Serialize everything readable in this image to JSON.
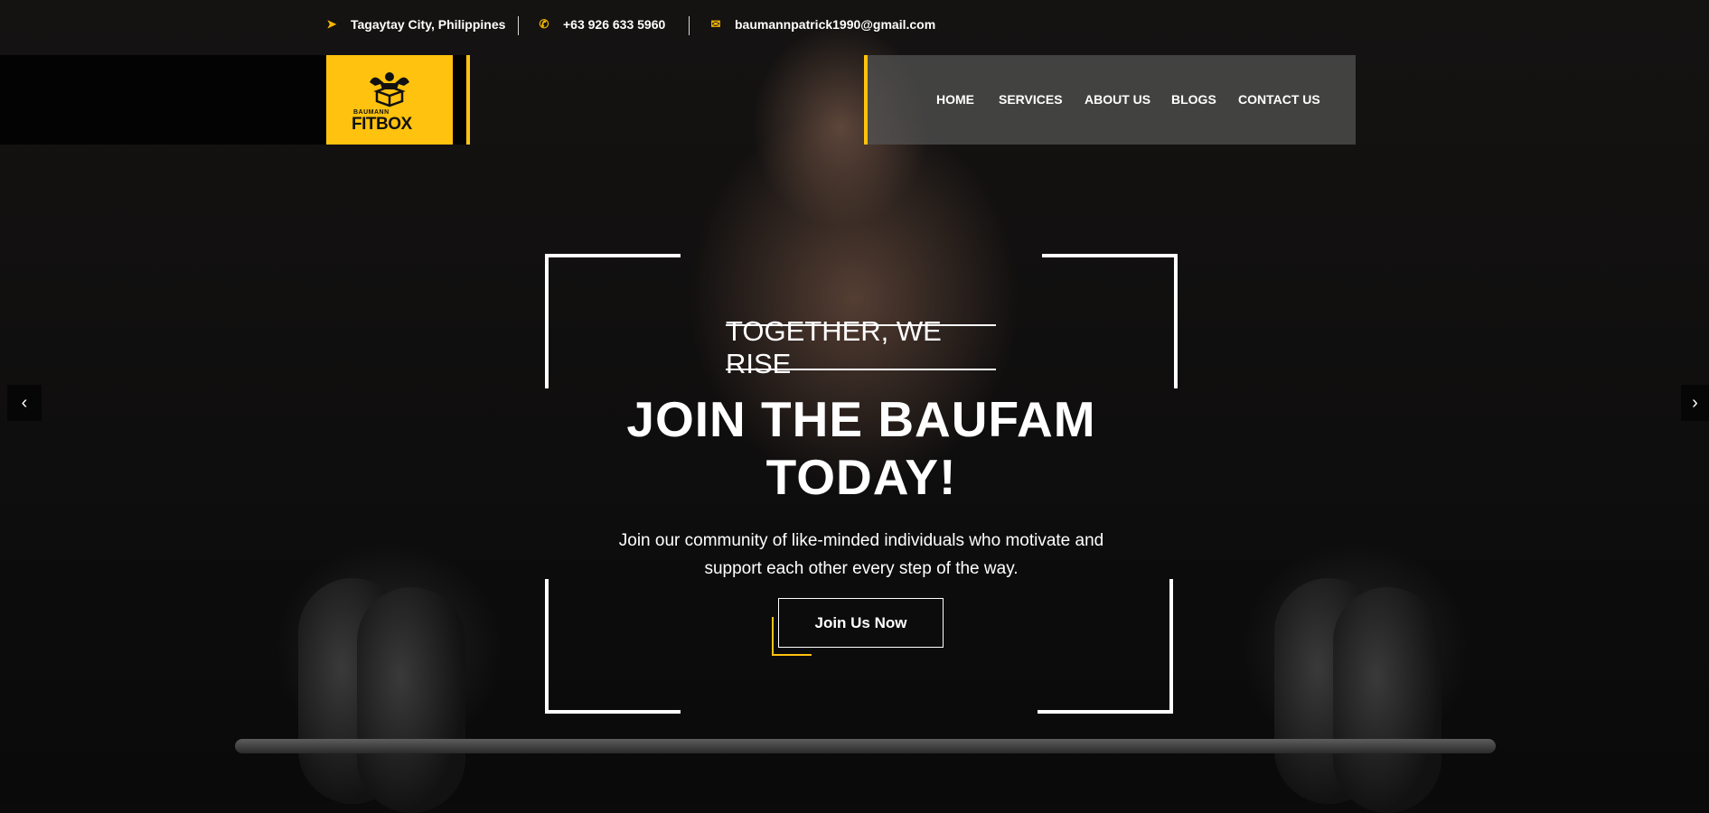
{
  "topbar": {
    "location": "Tagaytay City, Philippines",
    "phone": "+63 926 633 5960",
    "email": "baumannpatrick1990@gmail.com"
  },
  "logo": {
    "small": "BAUMANN",
    "big": "FITBOX"
  },
  "nav": {
    "home": "HOME",
    "services": "SERVICES",
    "about": "ABOUT US",
    "blogs": "BLOGS",
    "contact": "CONTACT US"
  },
  "hero": {
    "tagline": "TOGETHER, WE RISE",
    "headline_line1": "JOIN THE BAUFAM",
    "headline_line2": "TODAY!",
    "subtext_line1": "Join our community of like-minded individuals who motivate and",
    "subtext_line2": "support each other every step of the way.",
    "cta": "Join Us Now"
  },
  "icons": {
    "location": "location-arrow-icon",
    "phone": "phone-icon",
    "email": "envelope-icon",
    "prev": "chevron-left-icon",
    "next": "chevron-right-icon"
  },
  "colors": {
    "accent": "#ffc20e",
    "nav_bg": "#555555",
    "background": "#0b0b0b"
  }
}
